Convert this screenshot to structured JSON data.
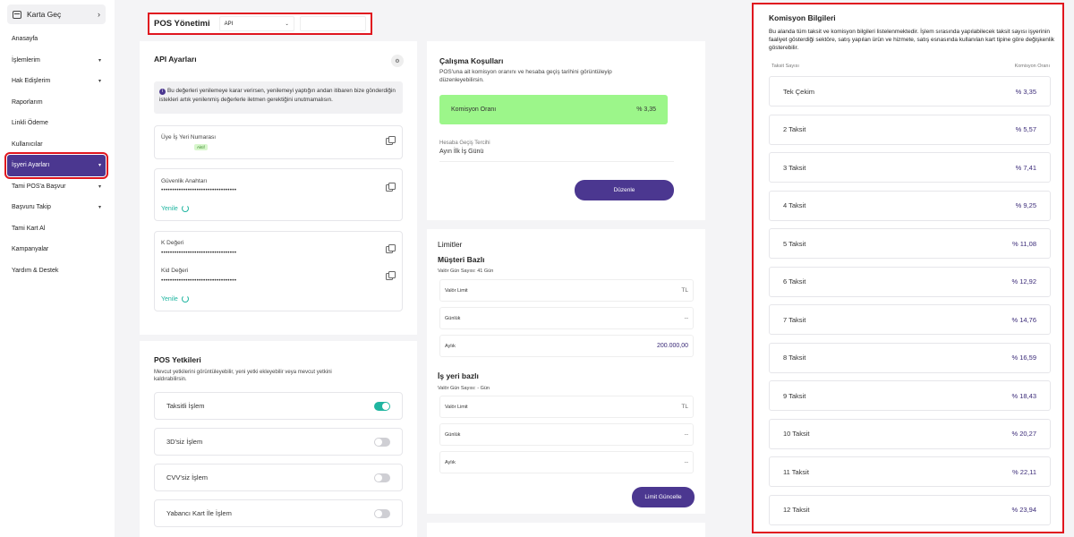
{
  "sidebar": {
    "karta": "Karta Geç",
    "items": [
      {
        "label": "Anasayfa",
        "caret": false,
        "active": false
      },
      {
        "label": "İşlemlerim",
        "caret": true,
        "active": false
      },
      {
        "label": "Hak Edişlerim",
        "caret": true,
        "active": false
      },
      {
        "label": "Raporlarım",
        "caret": false,
        "active": false
      },
      {
        "label": "Linkli Ödeme",
        "caret": false,
        "active": false
      },
      {
        "label": "Kullanıcılar",
        "caret": false,
        "active": false
      },
      {
        "label": "İşyeri Ayarları",
        "caret": true,
        "active": true
      },
      {
        "label": "Tami POS'a Başvur",
        "caret": true,
        "active": false
      },
      {
        "label": "Başvuru Takip",
        "caret": true,
        "active": false
      },
      {
        "label": "Tami Kart Al",
        "caret": false,
        "active": false
      },
      {
        "label": "Kampanyalar",
        "caret": false,
        "active": false
      },
      {
        "label": "Yardım & Destek",
        "caret": false,
        "active": false
      }
    ]
  },
  "header": {
    "title": "POS Yönetimi",
    "select_value": "API"
  },
  "api": {
    "title": "API Ayarları",
    "info": "Bu değerleri yenilemeye karar verirsen, yenilemeyi yaptığın andan itibaren bize gönderdiğin istekleri artık yenilenmiş değerlerle iletmen gerektiğini unutmamalısın.",
    "uye_label": "Üye İş Yeri Numarası",
    "uye_badge": "Aktif",
    "guv_label": "Güvenlik Anahtarı",
    "guv_value": "••••••••••••••••••••••••••••••••••",
    "yenile": "Yenile",
    "k_label": "K Değeri",
    "k_value": "••••••••••••••••••••••••••••••••••",
    "kid_label": "Kid Değeri",
    "kid_value": "••••••••••••••••••••••••••••••••••"
  },
  "pos": {
    "title": "POS Yetkileri",
    "desc": "Mevcut yetkilerini görüntüleyebilir, yeni yetki ekleyebilir veya mevcut yetkini kaldırabilirsin.",
    "perms": [
      {
        "label": "Taksitli İşlem",
        "on": true
      },
      {
        "label": "3D'siz İşlem",
        "on": false
      },
      {
        "label": "CVV'siz İşlem",
        "on": false
      },
      {
        "label": "Yabancı Kart İle İşlem",
        "on": false
      }
    ]
  },
  "calisma": {
    "title": "Çalışma Koşulları",
    "desc": "POS'una ait komisyon oranını ve hesaba geçiş tarihini görüntüleyip düzenleyebilirsin.",
    "oran_label": "Komisyon Oranı",
    "oran_value": "% 3,35",
    "tercih_label": "Hesaba Geçiş Tercihi",
    "tercih_value": "Ayın İlk İş Günü",
    "button": "Düzenle"
  },
  "limitler": {
    "title": "Limitler",
    "musteri_title": "Müşteri Bazlı",
    "musteri_sub": "Valör Gün Sayısı: 41 Gün",
    "musteri_rows": [
      {
        "label": "Valör Limit",
        "value": "TL"
      },
      {
        "label": "Günlük",
        "value": "--"
      },
      {
        "label": "Aylık",
        "value": "200.000,00"
      }
    ],
    "isyeri_title": "İş yeri bazlı",
    "isyeri_sub": "Valör Gün Sayısı: - Gün",
    "isyeri_rows": [
      {
        "label": "Valör Limit",
        "value": "TL"
      },
      {
        "label": "Günlük",
        "value": "--"
      },
      {
        "label": "Aylık",
        "value": "--"
      }
    ],
    "button": "Limit Güncelle"
  },
  "komisyon": {
    "title": "Komisyon Bilgileri",
    "desc": "Bu alanda tüm taksit ve komisyon bilgileri listelenmektedir. İşlem sırasında yapılabilecek taksit sayısı işyerinin faaliyet gösterdiği sektöre, satış yapılan ürün ve hizmete, satış esnasında kullanılan kart tipine göre değişkenlik gösterebilir.",
    "col_left": "Taksit Sayısı",
    "col_right": "Komisyon Oranı",
    "rows": [
      {
        "label": "Tek Çekim",
        "value": "% 3,35"
      },
      {
        "label": "2 Taksit",
        "value": "% 5,57"
      },
      {
        "label": "3 Taksit",
        "value": "% 7,41"
      },
      {
        "label": "4 Taksit",
        "value": "% 9,25"
      },
      {
        "label": "5 Taksit",
        "value": "% 11,08"
      },
      {
        "label": "6 Taksit",
        "value": "% 12,92"
      },
      {
        "label": "7 Taksit",
        "value": "% 14,76"
      },
      {
        "label": "8 Taksit",
        "value": "% 16,59"
      },
      {
        "label": "9 Taksit",
        "value": "% 18,43"
      },
      {
        "label": "10 Taksit",
        "value": "% 20,27"
      },
      {
        "label": "11 Taksit",
        "value": "% 22,11"
      },
      {
        "label": "12 Taksit",
        "value": "% 23,94"
      }
    ]
  },
  "colors": {
    "accent": "#4b3790",
    "teal": "#1fb5a0",
    "green": "#9cf68a",
    "highlight": "#e0161f"
  }
}
